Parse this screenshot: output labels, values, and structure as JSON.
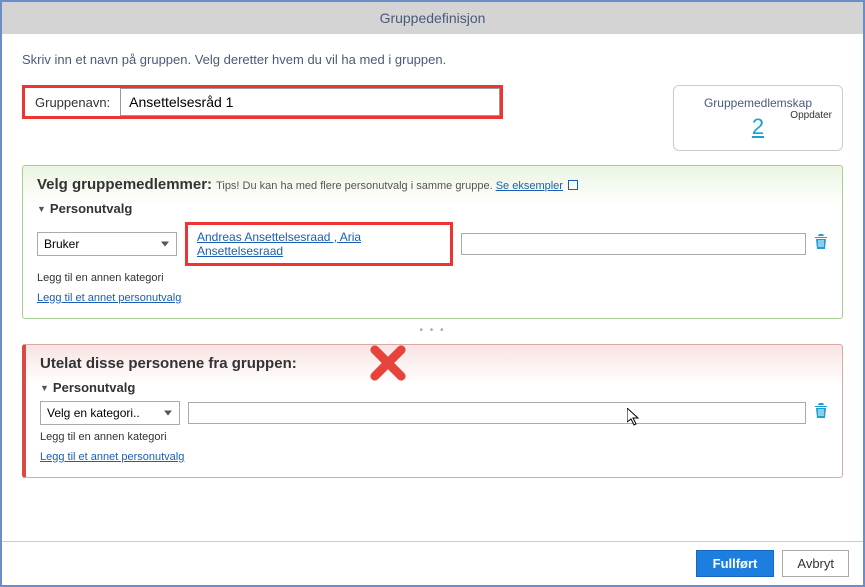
{
  "title": "Gruppedefinisjon",
  "intro": "Skriv inn et navn på gruppen. Velg deretter hvem du vil ha med i gruppen.",
  "groupname": {
    "label": "Gruppenavn:",
    "value": "Ansettelsesråd 1"
  },
  "sidecard": {
    "title": "Gruppemedlemskap",
    "count": "2",
    "update": "Oppdater"
  },
  "include": {
    "header": "Velg gruppemedlemmer:",
    "tips_prefix": "Tips! Du kan ha med flere personutvalg i samme gruppe.",
    "tips_link": "Se eksempler",
    "sub_title": "Personutvalg",
    "select_value": "Bruker",
    "field_value": "Andreas Ansettelsesraad , Aria Ansettelsesraad",
    "add_category": "Legg til en annen kategori",
    "add_selection": "Legg til et annet personutvalg"
  },
  "exclude": {
    "header": "Utelat disse personene fra gruppen:",
    "sub_title": "Personutvalg",
    "select_value": "Velg en kategori..",
    "add_category": "Legg til en annen kategori",
    "add_selection": "Legg til et annet personutvalg"
  },
  "footer": {
    "primary": "Fullført",
    "secondary": "Avbryt"
  }
}
